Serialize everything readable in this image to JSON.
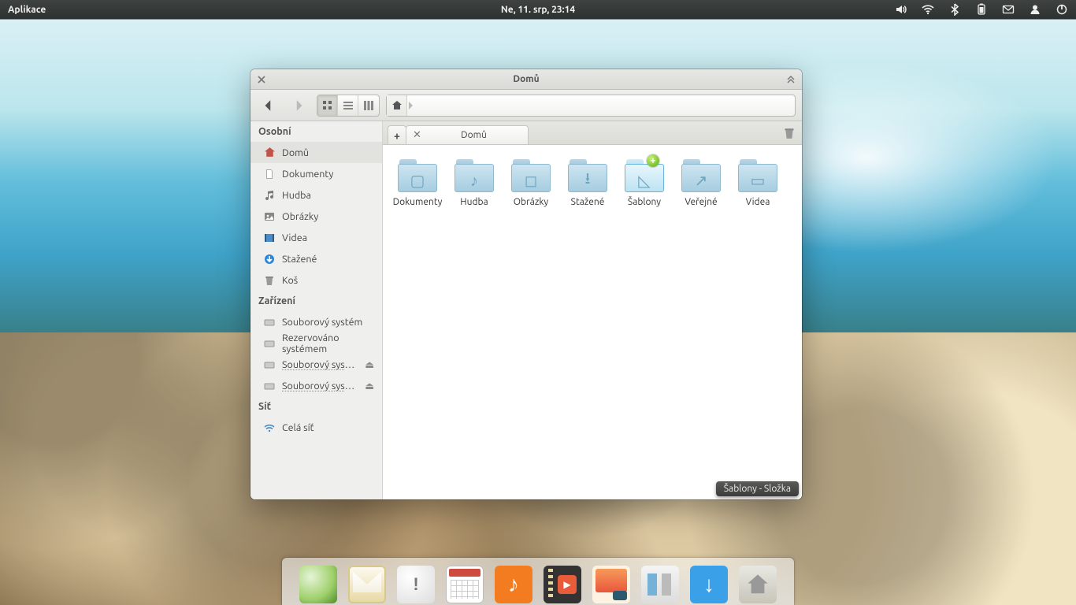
{
  "panel": {
    "app_label": "Aplikace",
    "clock": "Ne, 11. srp, 23:14"
  },
  "window": {
    "title": "Domů"
  },
  "tab": {
    "label": "Domů"
  },
  "sidebar": {
    "personal_head": "Osobní",
    "devices_head": "Zařízení",
    "network_head": "Síť",
    "items": {
      "home": "Domů",
      "documents": "Dokumenty",
      "music": "Hudba",
      "pictures": "Obrázky",
      "videos": "Videa",
      "downloads": "Stažené",
      "trash": "Koš",
      "filesystem": "Souborový systém",
      "reserved": "Rezervováno systémem",
      "fs_trunc": "Souborový systé…",
      "network_all": "Celá síť"
    }
  },
  "folders": {
    "documents": "Dokumenty",
    "music": "Hudba",
    "pictures": "Obrázky",
    "downloads": "Stažené",
    "templates": "Šablony",
    "public": "Veřejné",
    "videos": "Videa"
  },
  "tooltip": "Šablony - Složka"
}
